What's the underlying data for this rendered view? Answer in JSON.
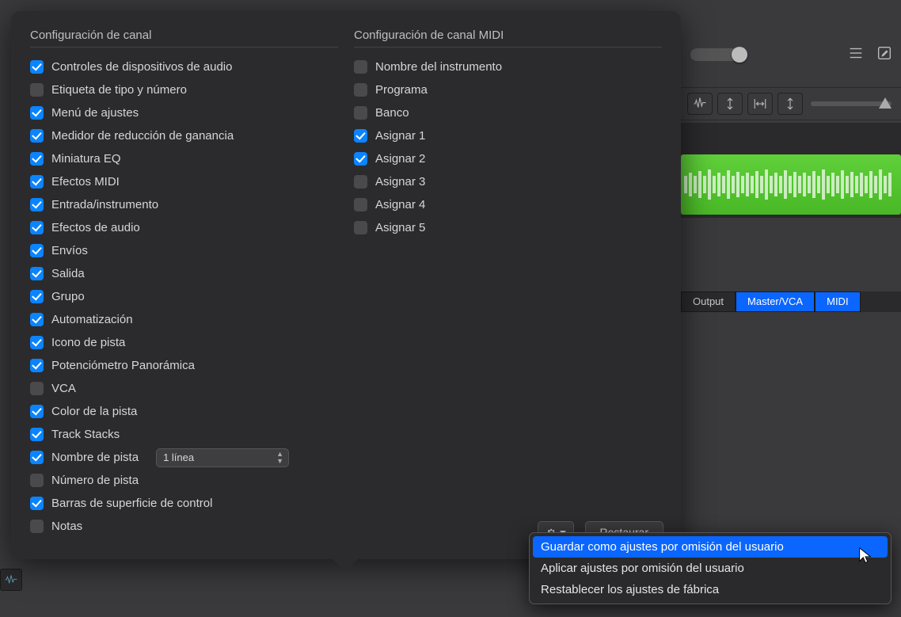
{
  "popover": {
    "left": {
      "title": "Configuración de canal",
      "items": [
        {
          "label": "Controles de dispositivos de audio",
          "on": true
        },
        {
          "label": "Etiqueta de tipo y número",
          "on": false
        },
        {
          "label": "Menú de ajustes",
          "on": true
        },
        {
          "label": "Medidor de reducción de ganancia",
          "on": true
        },
        {
          "label": "Miniatura EQ",
          "on": true
        },
        {
          "label": "Efectos MIDI",
          "on": true
        },
        {
          "label": "Entrada/instrumento",
          "on": true
        },
        {
          "label": "Efectos de audio",
          "on": true
        },
        {
          "label": "Envíos",
          "on": true
        },
        {
          "label": "Salida",
          "on": true
        },
        {
          "label": "Grupo",
          "on": true
        },
        {
          "label": "Automatización",
          "on": true
        },
        {
          "label": "Icono de pista",
          "on": true
        },
        {
          "label": "Potenciómetro Panorámica",
          "on": true
        },
        {
          "label": "VCA",
          "on": false
        },
        {
          "label": "Color de la pista",
          "on": true
        },
        {
          "label": "Track Stacks",
          "on": true
        },
        {
          "label": "Nombre de pista",
          "on": true,
          "select": "1 línea"
        },
        {
          "label": "Número de pista",
          "on": false
        },
        {
          "label": "Barras de superficie de control",
          "on": true
        },
        {
          "label": "Notas",
          "on": false
        }
      ]
    },
    "right": {
      "title": "Configuración de canal MIDI",
      "items": [
        {
          "label": "Nombre del instrumento",
          "on": false
        },
        {
          "label": "Programa",
          "on": false
        },
        {
          "label": "Banco",
          "on": false
        },
        {
          "label": "Asignar 1",
          "on": true
        },
        {
          "label": "Asignar 2",
          "on": true
        },
        {
          "label": "Asignar 3",
          "on": false
        },
        {
          "label": "Asignar 4",
          "on": false
        },
        {
          "label": "Asignar 5",
          "on": false
        }
      ]
    },
    "restore": "Restaurar"
  },
  "menu": {
    "items": [
      "Guardar como ajustes por omisión del usuario",
      "Aplicar ajustes por omisión del usuario",
      "Restablecer los ajustes de fábrica"
    ],
    "active": 0
  },
  "tabs": {
    "output": "Output",
    "master": "Master/VCA",
    "midi": "MIDI"
  }
}
